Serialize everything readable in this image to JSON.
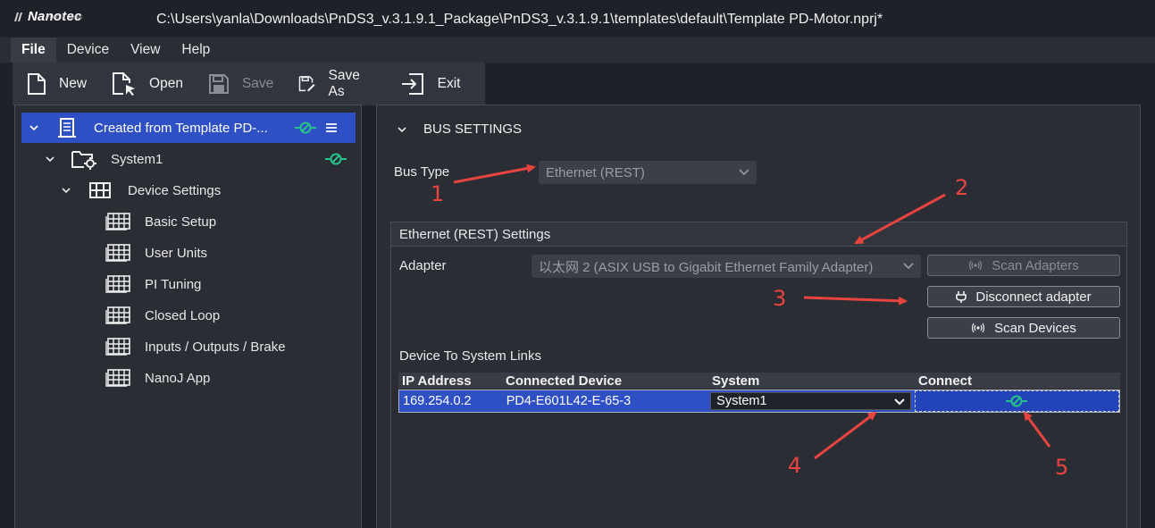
{
  "app": {
    "logo_text": "Nanotec",
    "logo_tagline": "PLUG & DRIVE",
    "window_title": "C:\\Users\\yanla\\Downloads\\PnDS3_v.3.1.9.1_Package\\PnDS3_v.3.1.9.1\\templates\\default\\Template PD-Motor.nprj*"
  },
  "menu": {
    "items": [
      {
        "label": "File",
        "active": true
      },
      {
        "label": "Device",
        "active": false
      },
      {
        "label": "View",
        "active": false
      },
      {
        "label": "Help",
        "active": false
      }
    ]
  },
  "toolbar": {
    "new_label": "New",
    "open_label": "Open",
    "save_label": "Save",
    "save_as_label": "Save As",
    "exit_label": "Exit"
  },
  "tree": {
    "root_label": "Created from Template PD-...",
    "system_label": "System1",
    "device_settings_label": "Device Settings",
    "children": [
      {
        "label": "Basic Setup"
      },
      {
        "label": "User Units"
      },
      {
        "label": "PI Tuning"
      },
      {
        "label": "Closed Loop"
      },
      {
        "label": "Inputs / Outputs / Brake"
      },
      {
        "label": "NanoJ App"
      }
    ]
  },
  "bus": {
    "section_title": "BUS SETTINGS",
    "bus_type_label": "Bus Type",
    "bus_type_value": "Ethernet (REST)",
    "group_title": "Ethernet (REST) Settings",
    "adapter_label": "Adapter",
    "adapter_value": "以太网 2 (ASIX USB to Gigabit Ethernet Family Adapter)",
    "scan_adapters_label": "Scan Adapters",
    "disconnect_adapter_label": "Disconnect adapter",
    "scan_devices_label": "Scan Devices",
    "links_title": "Device To System Links"
  },
  "links_table": {
    "headers": [
      "IP Address",
      "Connected Device",
      "System",
      "Connect"
    ],
    "rows": [
      {
        "ip": "169.254.0.2",
        "device": "PD4-E601L42-E-65-3",
        "system": "System1"
      }
    ]
  },
  "annotations": [
    "1",
    "2",
    "3",
    "4",
    "5"
  ],
  "colors": {
    "selection": "#2f4fc4",
    "connected_green": "#27c28a",
    "annotation_red": "#e8443f"
  }
}
